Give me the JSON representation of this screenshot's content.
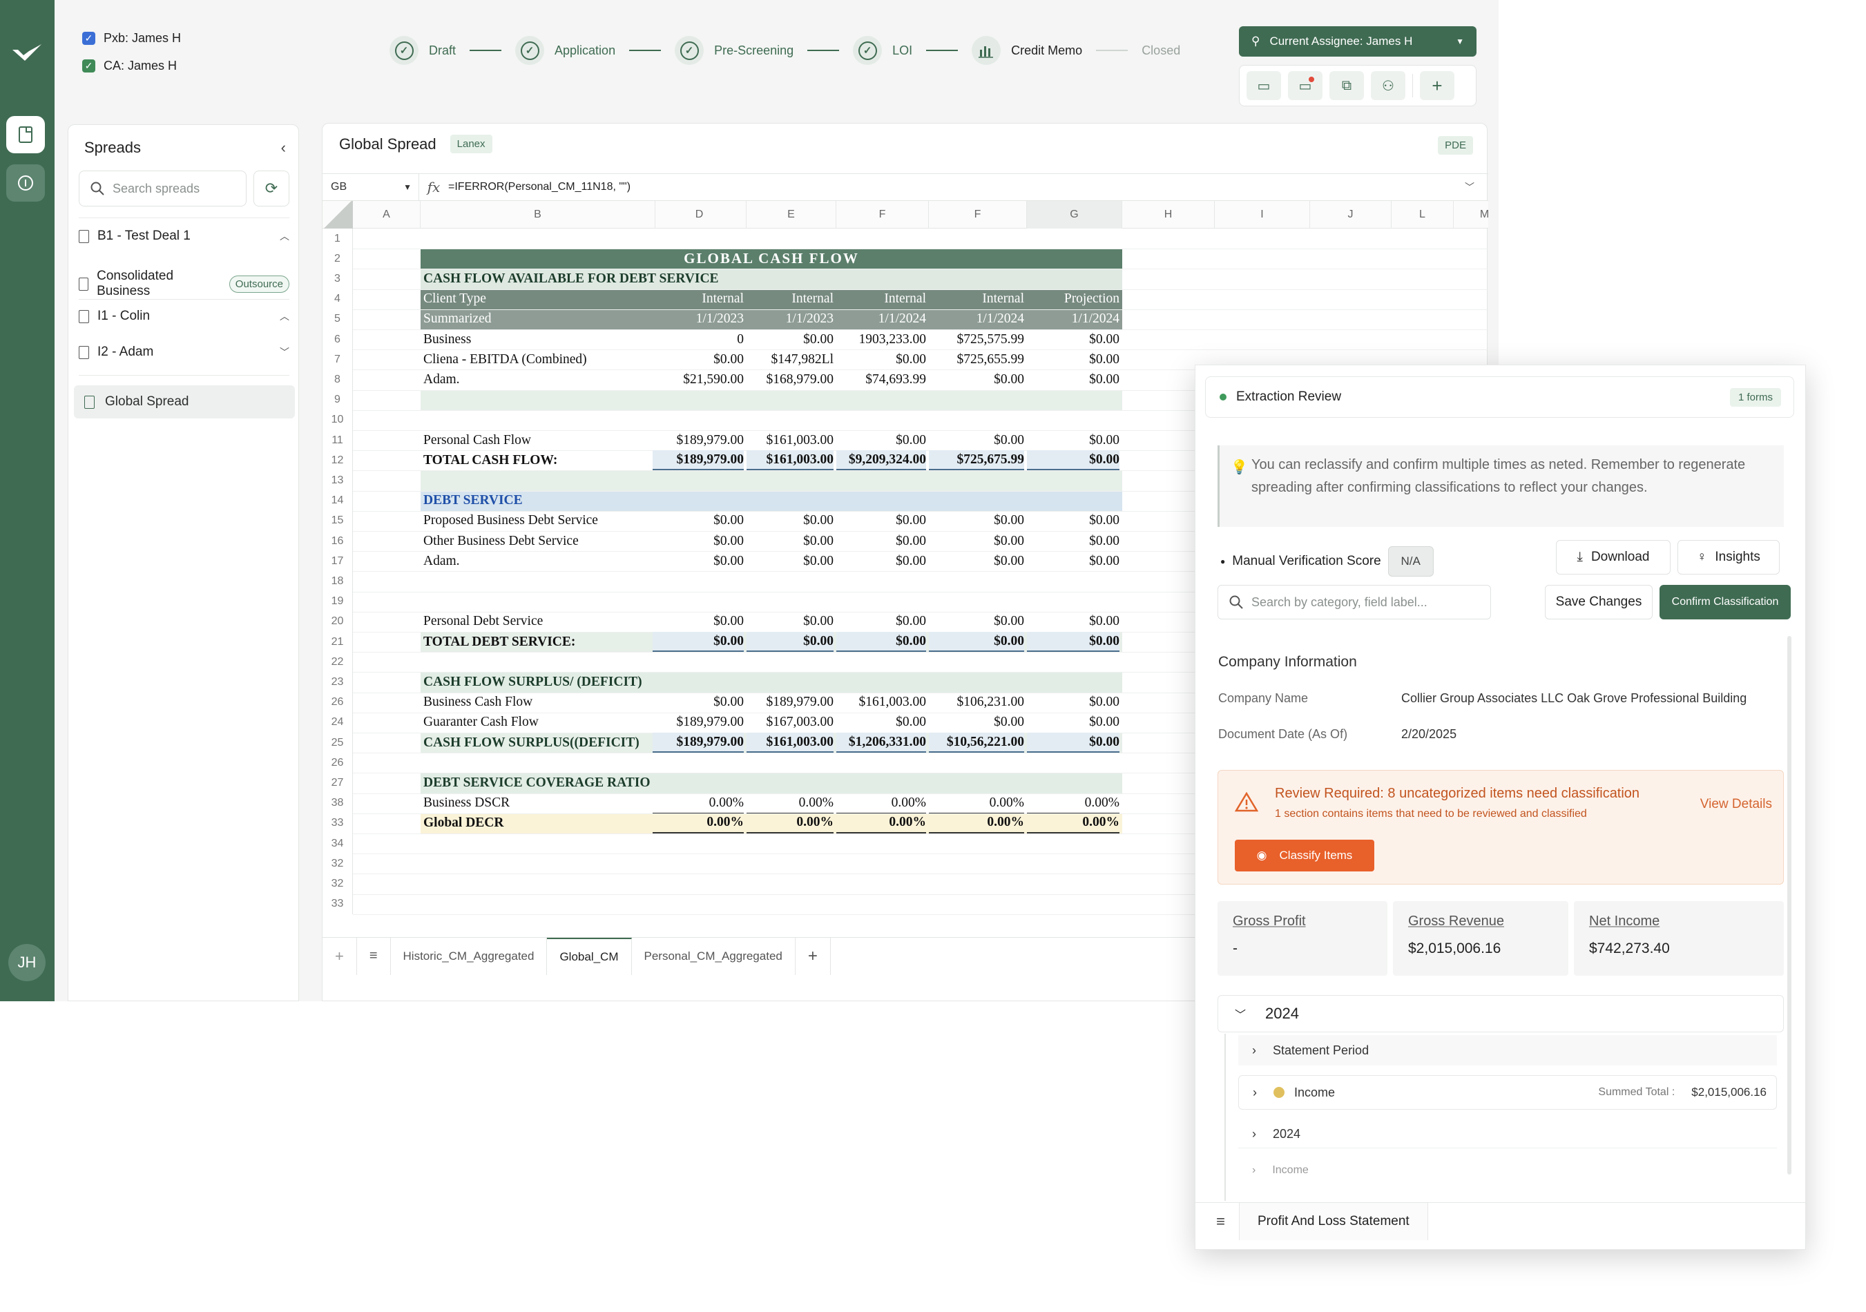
{
  "rail": {
    "avatar_initials": "JH"
  },
  "top": {
    "checks": [
      "Pxb: James H",
      "CA: James H"
    ],
    "steps": [
      {
        "label": "Draft",
        "state": "done"
      },
      {
        "label": "Application",
        "state": "done"
      },
      {
        "label": "Pre-Screening",
        "state": "done"
      },
      {
        "label": "LOI",
        "state": "done"
      },
      {
        "label": "Credit Memo",
        "state": "current"
      },
      {
        "label": "Closed",
        "state": "pending"
      }
    ],
    "assignee": "Current Assignee: James H"
  },
  "sidebar": {
    "title": "Spreads",
    "search_placeholder": "Search spreads",
    "items": [
      {
        "label": "B1 - Test Deal 1"
      },
      {
        "label": "Consolidated Business",
        "badge": "Outsource"
      },
      {
        "label": "I1 - Colin"
      },
      {
        "label": "I2 - Adam"
      },
      {
        "label": "Global Spread"
      }
    ]
  },
  "main": {
    "title": "Global Spread",
    "chip": "Lanex",
    "pdf": "PDE",
    "cell_ref": "GB",
    "formula": "=IFERROR(Personal_CM_11N18, \"\")",
    "columns": [
      "A",
      "B",
      "D",
      "E",
      "F",
      "F",
      "G",
      "H",
      "I",
      "J",
      "L",
      "M"
    ],
    "row_numbers": [
      "1",
      "2",
      "3",
      "4",
      "5",
      "6",
      "7",
      "8",
      "9",
      "10",
      "11",
      "12",
      "13",
      "14",
      "15",
      "16",
      "17",
      "18",
      "19",
      "20",
      "21",
      "22",
      "23",
      "26",
      "24",
      "25",
      "26",
      "27",
      "38",
      "33",
      "34",
      "32",
      "32",
      "33"
    ],
    "title_row": "GLOBAL CASH FLOW",
    "rows": [
      {
        "b": "CASH FLOW AVAILABLE FOR DEBT SERVICE",
        "v": []
      },
      {
        "b": "Client Type",
        "v": [
          "Internal",
          "Internal",
          "Internal",
          "Internal",
          "Projection"
        ]
      },
      {
        "b": "Summarized",
        "v": [
          "1/1/2023",
          "1/1/2023",
          "1/1/2024",
          "1/1/2024",
          "1/1/2024"
        ]
      },
      {
        "b": "Business",
        "v": [
          "0",
          "$0.00",
          "1903,233.00",
          "$725,575.99",
          "$0.00"
        ]
      },
      {
        "b": "Cliena - EBITDA (Combined)",
        "v": [
          "$0.00",
          "$147,982Ll",
          "$0.00",
          "$725,655.99",
          "$0.00"
        ]
      },
      {
        "b": "Adam.",
        "v": [
          "$21,590.00",
          "$168,979.00",
          "$74,693.99",
          "$0.00",
          "$0.00"
        ]
      },
      {
        "b": "Personal Cash Flow",
        "v": [
          "$189,979.00",
          "$161,003.00",
          "$0.00",
          "$0.00",
          "$0.00"
        ]
      },
      {
        "b": "TOTAL CASH FLOW:",
        "v": [
          "$189,979.00",
          "$161,003.00",
          "$9,209,324.00",
          "$725,675.99",
          "$0.00"
        ]
      },
      {
        "b": "DEBT SERVICE",
        "v": []
      },
      {
        "b": "Proposed Business Debt Service",
        "v": [
          "$0.00",
          "$0.00",
          "$0.00",
          "$0.00",
          "$0.00"
        ]
      },
      {
        "b": "Other Business Debt Service",
        "v": [
          "$0.00",
          "$0.00",
          "$0.00",
          "$0.00",
          "$0.00"
        ]
      },
      {
        "b": "Adam.",
        "v": [
          "$0.00",
          "$0.00",
          "$0.00",
          "$0.00",
          "$0.00"
        ]
      },
      {
        "b": "Personal Debt Service",
        "v": [
          "$0.00",
          "$0.00",
          "$0.00",
          "$0.00",
          "$0.00"
        ]
      },
      {
        "b": "TOTAL DEBT SERVICE:",
        "v": [
          "$0.00",
          "$0.00",
          "$0.00",
          "$0.00",
          "$0.00"
        ]
      },
      {
        "b": "CASH FLOW SURPLUS/ (DEFICIT)",
        "v": []
      },
      {
        "b": "Business Cash Flow",
        "v": [
          "$0.00",
          "$189,979.00",
          "$161,003.00",
          "$106,231.00",
          "$0.00"
        ]
      },
      {
        "b": "Guaranter Cash Flow",
        "v": [
          "$189,979.00",
          "$167,003.00",
          "$0.00",
          "$0.00",
          "$0.00"
        ]
      },
      {
        "b": "CASH FLOW SURPLUS((DEFICIT)",
        "v": [
          "$189,979.00",
          "$161,003.00",
          "$1,206,331.00",
          "$10,56,221.00",
          "$0.00"
        ]
      },
      {
        "b": "DEBT SERVICE COVERAGE RATIO",
        "v": []
      },
      {
        "b": "Business DSCR",
        "v": [
          "0.00%",
          "0.00%",
          "0.00%",
          "0.00%",
          "0.00%"
        ]
      },
      {
        "b": "Global DECR",
        "v": [
          "0.00%",
          "0.00%",
          "0.00%",
          "0.00%",
          "0.00%"
        ]
      }
    ],
    "tabs": [
      "Historic_CM_Aggregated",
      "Global_CM",
      "Personal_CM_Aggregated"
    ]
  },
  "panel": {
    "title": "Extraction Review",
    "forms": "1 forms",
    "note": "You can reclassify and confirm multiple times as neted. Remember to regenerate spreading after confirming classifications to reflect your changes.",
    "mvs_label": "Manual Verification Score",
    "mvs_value": "N/A",
    "download": "Download",
    "insights": "Insights",
    "search_placeholder": "Search by category, field label...",
    "save": "Save Changes",
    "confirm": "Confirm Classification",
    "company_section": "Company Information",
    "company_name_label": "Company Name",
    "company_name": "Collier Group Associates LLC Oak Grove Professional Building",
    "doc_date_label": "Document Date (As Of)",
    "doc_date": "2/20/2025",
    "warn_title": "Review Required: 8 uncategorized items need classification",
    "warn_sub": "1 section contains items that need to be reviewed and classified",
    "view_details": "View Details",
    "classify": "Classify Items",
    "metrics": [
      {
        "label": "Gross Profit",
        "value": "-"
      },
      {
        "label": "Gross Revenue",
        "value": "$2,015,006.16"
      },
      {
        "label": "Net Income",
        "value": "$742,273.40"
      }
    ],
    "year": "2024",
    "tree": {
      "statement_period": "Statement Period",
      "income": "Income",
      "summed_label": "Summed Total :",
      "summed_value": "$2,015,006.16",
      "year2": "2024",
      "income2": "Income"
    },
    "footer_tab": "Profit And Loss Statement"
  },
  "colors": {
    "brand": "#3f6b52",
    "accent_orange": "#e8602a"
  }
}
